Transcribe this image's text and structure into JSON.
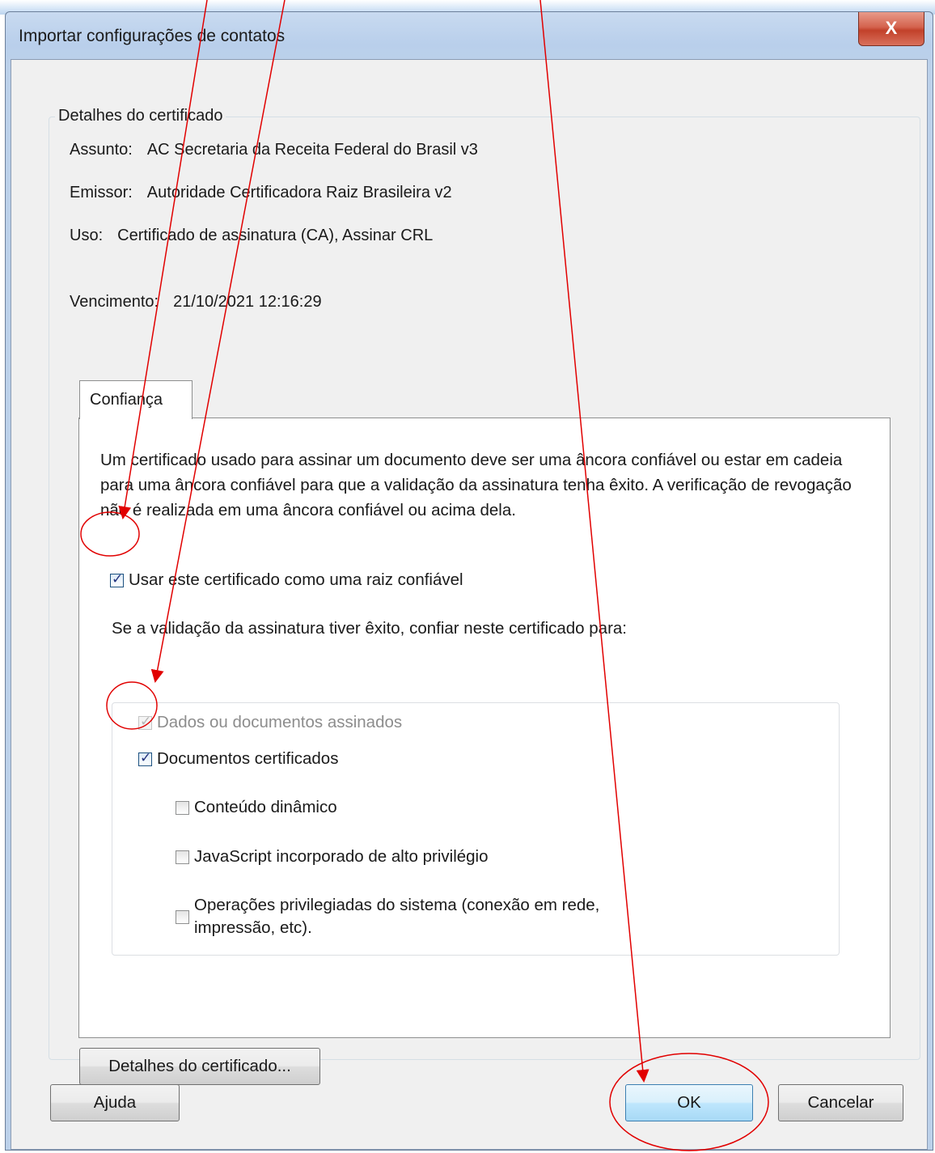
{
  "window": {
    "title": "Importar configurações de contatos",
    "close_glyph": "X"
  },
  "details_group": {
    "legend": "Detalhes do certificado",
    "subject_label": "Assunto:",
    "subject_value": "AC Secretaria da Receita Federal do Brasil v3",
    "issuer_label": "Emissor:",
    "issuer_value": "Autoridade Certificadora Raiz Brasileira v2",
    "usage_label": "Uso:",
    "usage_value": "Certificado de assinatura (CA), Assinar CRL",
    "expiry_label": "Vencimento:",
    "expiry_value": "21/10/2021 12:16:29"
  },
  "trust_tab": {
    "tab_label": "Confiança",
    "description": "Um certificado usado para assinar um documento deve ser uma âncora confiável ou estar em cadeia para uma âncora confiável para que a validação da assinatura tenha êxito. A verificação de revogação não é realizada em uma âncora confiável ou acima dela.",
    "use_as_root": {
      "label": "Usar este certificado como uma raiz confiável",
      "checked": true
    },
    "trust_for_text": "Se a validação da assinatura tiver êxito, confiar neste certificado para:",
    "options": [
      {
        "label": "Dados ou documentos assinados",
        "checked": true,
        "disabled": true
      },
      {
        "label": "Documentos certificados",
        "checked": true,
        "disabled": false
      },
      {
        "label": "Conteúdo dinâmico",
        "checked": false,
        "disabled": false
      },
      {
        "label": "JavaScript incorporado de alto privilégio",
        "checked": false,
        "disabled": false
      },
      {
        "label": "Operações privilegiadas do sistema (conexão em rede, impressão, etc).",
        "checked": false,
        "disabled": false
      }
    ]
  },
  "buttons": {
    "cert_details": "Detalhes do certificado...",
    "help": "Ajuda",
    "ok": "OK",
    "cancel": "Cancelar"
  },
  "annotation": {
    "color": "#e10000"
  }
}
